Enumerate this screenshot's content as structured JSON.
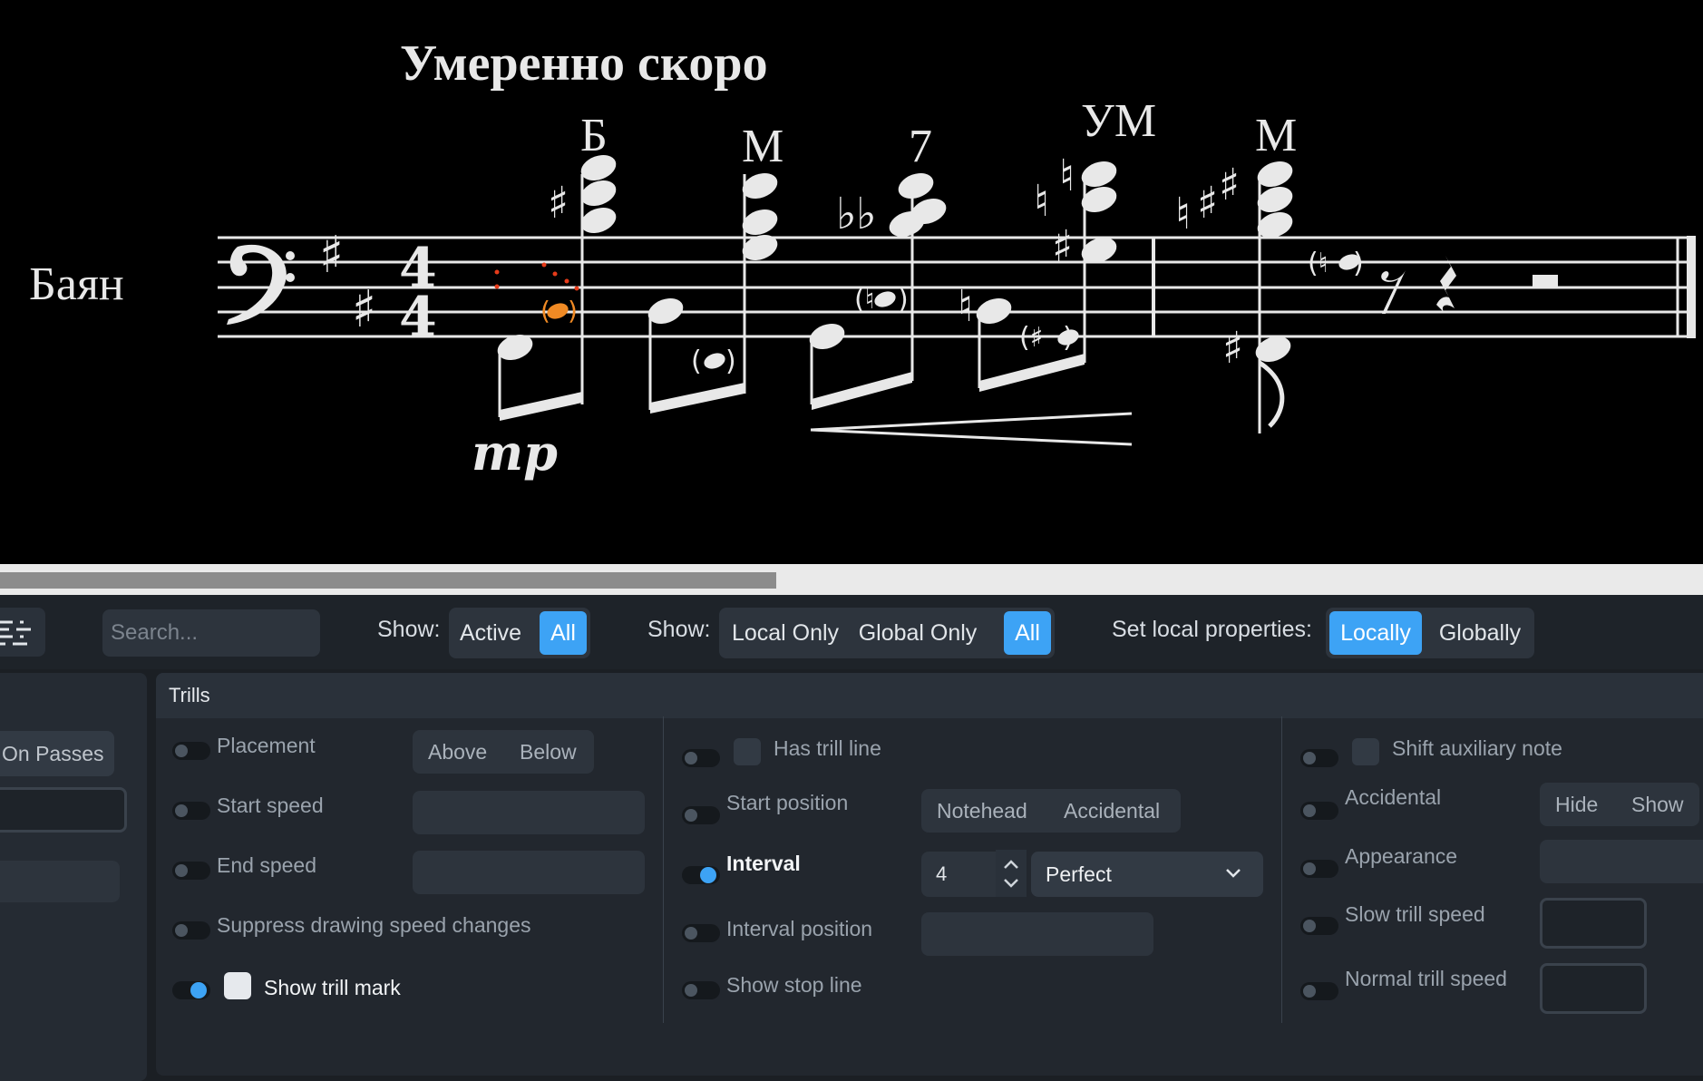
{
  "score": {
    "tempo": "Умеренно скоро",
    "instrument": "Баян",
    "time_sig_top": "4",
    "time_sig_bottom": "4",
    "dynamic": "mp",
    "chord_labels": [
      "Б",
      "М",
      "7",
      "УМ",
      "М"
    ]
  },
  "toolbar": {
    "search_placeholder": "Search...",
    "show1_label": "Show:",
    "show1_options": [
      "Active",
      "All"
    ],
    "show1_selected": "All",
    "show2_label": "Show:",
    "show2_options": [
      "Local Only",
      "Global Only",
      "All"
    ],
    "show2_selected": "All",
    "set_local_label": "Set local properties:",
    "set_local_options": [
      "Locally",
      "Globally"
    ],
    "set_local_selected": "Locally"
  },
  "left_column": {
    "on_passes": "On Passes"
  },
  "section": {
    "title": "Trills",
    "col1": {
      "placement": "Placement",
      "placement_options": [
        "Above",
        "Below"
      ],
      "start_speed": "Start speed",
      "end_speed": "End speed",
      "suppress": "Suppress drawing speed changes",
      "show_trill_mark": "Show trill mark"
    },
    "col2": {
      "has_trill_line": "Has trill line",
      "start_position": "Start position",
      "start_position_options": [
        "Notehead",
        "Accidental"
      ],
      "interval": "Interval",
      "interval_number": "4",
      "interval_quality": "Perfect",
      "interval_position": "Interval position",
      "show_stop_line": "Show stop line"
    },
    "col3": {
      "shift_aux": "Shift auxiliary note",
      "accidental": "Accidental",
      "accidental_options": [
        "Hide",
        "Show"
      ],
      "appearance": "Appearance",
      "slow_trill_speed": "Slow trill speed",
      "normal_trill_speed": "Normal trill speed"
    }
  },
  "colors": {
    "accent": "#3da3f5",
    "score_bg": "#000000",
    "panel_bg": "#22272e",
    "selection": "#f08a24"
  }
}
